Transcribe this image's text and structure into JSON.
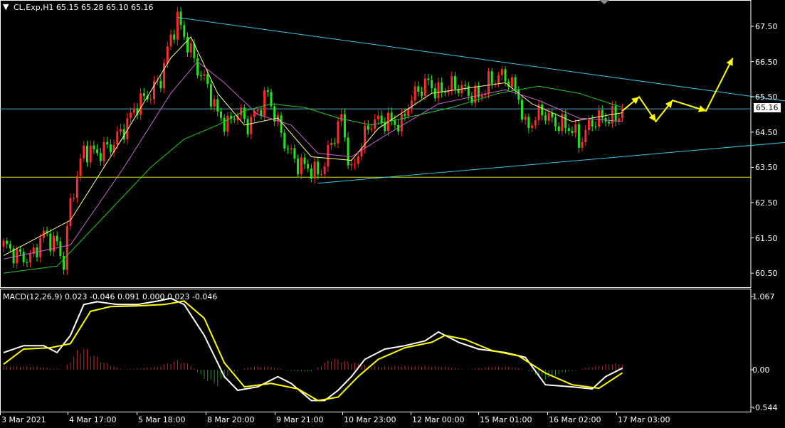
{
  "header": {
    "symbol_title": "CL.Exp,H1  65.15 65.28 65.10 65.16",
    "macd_title": "MACD(12,26,9) 0.023 -0.046 0.091 0.000 0.023 -0.046"
  },
  "current_price_tag": "65.16",
  "colors": {
    "background": "#000000",
    "axis": "#ffffff",
    "bull_candle": "#ff2a2a",
    "bear_candle": "#1ee61e",
    "trendline": "#33c8e6",
    "support_line": "#e6e600",
    "price_line": "#5fa0c8",
    "ma_fast": "#ffff80",
    "ma_mid": "#d060d0",
    "ma_slow": "#22cc22",
    "arrow": "#ffff00",
    "macd_line": "#ffffff",
    "signal_line": "#ffff00"
  },
  "icons": {
    "menu": "triangle-down-icon",
    "scroll": "triangle-down-icon"
  },
  "chart_data": [
    {
      "type": "candlestick",
      "title": "CL.Exp,H1",
      "ylim": [
        60.15,
        68.1
      ],
      "y_ticks": [
        "67.50",
        "66.50",
        "65.50",
        "64.50",
        "63.50",
        "62.50",
        "61.50",
        "60.50"
      ],
      "x_ticks": [
        "3 Mar 2021",
        "4 Mar 17:00",
        "5 Mar 18:00",
        "8 Mar 20:00",
        "9 Mar 21:00",
        "10 Mar 23:00",
        "12 Mar 00:00",
        "15 Mar 01:00",
        "16 Mar 02:00",
        "17 Mar 03:00"
      ],
      "last": {
        "open": 65.15,
        "high": 65.28,
        "low": 65.1,
        "close": 65.16
      },
      "current_price": 65.16,
      "support_level": 63.22,
      "close_path": [
        [
          0,
          61.3
        ],
        [
          4,
          61.0
        ],
        [
          8,
          60.9
        ],
        [
          12,
          61.6
        ],
        [
          16,
          61.3
        ],
        [
          18,
          60.8
        ],
        [
          20,
          62.5
        ],
        [
          24,
          64.0
        ],
        [
          28,
          63.9
        ],
        [
          32,
          64.1
        ],
        [
          36,
          64.6
        ],
        [
          40,
          65.3
        ],
        [
          44,
          65.6
        ],
        [
          47,
          66.0
        ],
        [
          50,
          67.2
        ],
        [
          52,
          67.7
        ],
        [
          55,
          67.0
        ],
        [
          58,
          66.3
        ],
        [
          61,
          65.8
        ],
        [
          64,
          65.0
        ],
        [
          67,
          64.7
        ],
        [
          70,
          65.1
        ],
        [
          73,
          64.7
        ],
        [
          76,
          65.1
        ],
        [
          79,
          65.6
        ],
        [
          82,
          64.7
        ],
        [
          85,
          64.0
        ],
        [
          88,
          63.6
        ],
        [
          91,
          63.5
        ],
        [
          94,
          63.3
        ],
        [
          96,
          63.6
        ],
        [
          98,
          64.2
        ],
        [
          101,
          64.9
        ],
        [
          104,
          63.3
        ],
        [
          107,
          64.2
        ],
        [
          110,
          64.8
        ],
        [
          113,
          64.8
        ],
        [
          116,
          64.8
        ],
        [
          119,
          64.7
        ],
        [
          121,
          65.3
        ],
        [
          124,
          65.7
        ],
        [
          127,
          65.9
        ],
        [
          130,
          65.6
        ],
        [
          133,
          65.8
        ],
        [
          136,
          65.8
        ],
        [
          139,
          65.6
        ],
        [
          142,
          65.5
        ],
        [
          145,
          65.9
        ],
        [
          148,
          66.1
        ],
        [
          151,
          66.0
        ],
        [
          154,
          65.5
        ],
        [
          156,
          64.6
        ],
        [
          159,
          64.9
        ],
        [
          161,
          65.1
        ],
        [
          164,
          64.8
        ],
        [
          167,
          64.7
        ],
        [
          170,
          64.6
        ],
        [
          172,
          64.2
        ],
        [
          174,
          64.5
        ],
        [
          176,
          64.8
        ],
        [
          179,
          64.9
        ],
        [
          182,
          64.9
        ],
        [
          184,
          65.0
        ],
        [
          185,
          65.16
        ]
      ],
      "moving_averages": [
        {
          "role": "ma_fast",
          "path": [
            [
              0,
              61.0
            ],
            [
              20,
              62.0
            ],
            [
              36,
              64.4
            ],
            [
              50,
              66.6
            ],
            [
              56,
              67.2
            ],
            [
              64,
              65.6
            ],
            [
              72,
              64.7
            ],
            [
              82,
              64.9
            ],
            [
              92,
              63.8
            ],
            [
              104,
              63.7
            ],
            [
              112,
              64.6
            ],
            [
              128,
              65.6
            ],
            [
              150,
              65.9
            ],
            [
              158,
              65.3
            ],
            [
              170,
              64.8
            ],
            [
              185,
              65.05
            ]
          ]
        },
        {
          "role": "ma_mid",
          "path": [
            [
              0,
              60.9
            ],
            [
              20,
              61.3
            ],
            [
              36,
              63.5
            ],
            [
              50,
              65.6
            ],
            [
              58,
              66.5
            ],
            [
              66,
              65.9
            ],
            [
              76,
              65.0
            ],
            [
              86,
              64.7
            ],
            [
              94,
              63.9
            ],
            [
              104,
              63.8
            ],
            [
              114,
              64.4
            ],
            [
              130,
              65.3
            ],
            [
              150,
              65.7
            ],
            [
              160,
              65.4
            ],
            [
              172,
              64.9
            ],
            [
              185,
              64.8
            ]
          ]
        },
        {
          "role": "ma_slow",
          "path": [
            [
              0,
              60.5
            ],
            [
              16,
              60.7
            ],
            [
              24,
              61.5
            ],
            [
              34,
              62.5
            ],
            [
              44,
              63.5
            ],
            [
              54,
              64.3
            ],
            [
              64,
              64.7
            ],
            [
              72,
              65.1
            ],
            [
              80,
              65.3
            ],
            [
              90,
              65.2
            ],
            [
              100,
              64.9
            ],
            [
              110,
              64.7
            ],
            [
              120,
              64.9
            ],
            [
              134,
              65.2
            ],
            [
              148,
              65.6
            ],
            [
              160,
              65.8
            ],
            [
              172,
              65.6
            ],
            [
              185,
              65.2
            ]
          ]
        }
      ],
      "trendlines": [
        {
          "role": "resistance",
          "from": [
            52,
            67.75
          ],
          "to": [
            240,
            65.3
          ]
        },
        {
          "role": "support",
          "from": [
            94,
            63.05
          ],
          "to": [
            240,
            64.26
          ]
        }
      ],
      "forecast_arrow_path": [
        [
          185,
          65.1
        ],
        [
          190,
          65.5
        ],
        [
          195,
          64.8
        ],
        [
          200,
          65.4
        ],
        [
          210,
          65.1
        ],
        [
          218,
          66.6
        ]
      ]
    },
    {
      "type": "macd",
      "title": "MACD(12,26,9)",
      "ylim": [
        -0.544,
        1.067
      ],
      "y_ticks": [
        "1.067",
        "0.00",
        "-0.544"
      ],
      "values": {
        "macd": 0.023,
        "signal": -0.046,
        "histogram": 0.091
      },
      "macd_path": [
        [
          0,
          0.25
        ],
        [
          6,
          0.35
        ],
        [
          12,
          0.35
        ],
        [
          16,
          0.25
        ],
        [
          20,
          0.5
        ],
        [
          24,
          0.95
        ],
        [
          28,
          0.99
        ],
        [
          34,
          0.95
        ],
        [
          40,
          0.95
        ],
        [
          46,
          1.0
        ],
        [
          50,
          1.04
        ],
        [
          54,
          0.95
        ],
        [
          60,
          0.5
        ],
        [
          66,
          -0.1
        ],
        [
          70,
          -0.3
        ],
        [
          76,
          -0.25
        ],
        [
          82,
          -0.1
        ],
        [
          86,
          -0.2
        ],
        [
          92,
          -0.45
        ],
        [
          96,
          -0.45
        ],
        [
          100,
          -0.3
        ],
        [
          104,
          -0.1
        ],
        [
          108,
          0.15
        ],
        [
          114,
          0.3
        ],
        [
          120,
          0.35
        ],
        [
          126,
          0.42
        ],
        [
          130,
          0.55
        ],
        [
          136,
          0.4
        ],
        [
          142,
          0.3
        ],
        [
          150,
          0.25
        ],
        [
          156,
          0.18
        ],
        [
          162,
          -0.22
        ],
        [
          170,
          -0.25
        ],
        [
          176,
          -0.28
        ],
        [
          180,
          -0.1
        ],
        [
          185,
          0.023
        ]
      ],
      "signal_path": [
        [
          0,
          0.08
        ],
        [
          6,
          0.3
        ],
        [
          14,
          0.32
        ],
        [
          20,
          0.38
        ],
        [
          26,
          0.85
        ],
        [
          32,
          0.92
        ],
        [
          40,
          0.93
        ],
        [
          48,
          0.95
        ],
        [
          54,
          1.0
        ],
        [
          60,
          0.75
        ],
        [
          66,
          0.1
        ],
        [
          72,
          -0.25
        ],
        [
          80,
          -0.2
        ],
        [
          88,
          -0.28
        ],
        [
          94,
          -0.45
        ],
        [
          100,
          -0.4
        ],
        [
          106,
          -0.1
        ],
        [
          112,
          0.15
        ],
        [
          120,
          0.32
        ],
        [
          128,
          0.4
        ],
        [
          132,
          0.5
        ],
        [
          138,
          0.44
        ],
        [
          146,
          0.28
        ],
        [
          154,
          0.2
        ],
        [
          162,
          -0.05
        ],
        [
          170,
          -0.22
        ],
        [
          178,
          -0.27
        ],
        [
          185,
          -0.046
        ]
      ],
      "histogram": [
        [
          0,
          0.06
        ],
        [
          10,
          0.05
        ],
        [
          18,
          0.0
        ],
        [
          22,
          0.3
        ],
        [
          24,
          0.35
        ],
        [
          30,
          0.12
        ],
        [
          36,
          0.0
        ],
        [
          46,
          0.05
        ],
        [
          52,
          0.15
        ],
        [
          56,
          0.08
        ],
        [
          60,
          -0.15
        ],
        [
          64,
          -0.25
        ],
        [
          68,
          -0.05
        ],
        [
          74,
          0.05
        ],
        [
          80,
          0.05
        ],
        [
          86,
          -0.02
        ],
        [
          92,
          -0.03
        ],
        [
          98,
          0.18
        ],
        [
          104,
          0.12
        ],
        [
          110,
          0.05
        ],
        [
          118,
          0.06
        ],
        [
          126,
          0.06
        ],
        [
          132,
          0.05
        ],
        [
          138,
          0.0
        ],
        [
          146,
          0.05
        ],
        [
          152,
          0.05
        ],
        [
          156,
          0.0
        ],
        [
          162,
          -0.15
        ],
        [
          168,
          -0.04
        ],
        [
          176,
          0.05
        ],
        [
          182,
          0.1
        ],
        [
          185,
          0.091
        ]
      ]
    }
  ]
}
